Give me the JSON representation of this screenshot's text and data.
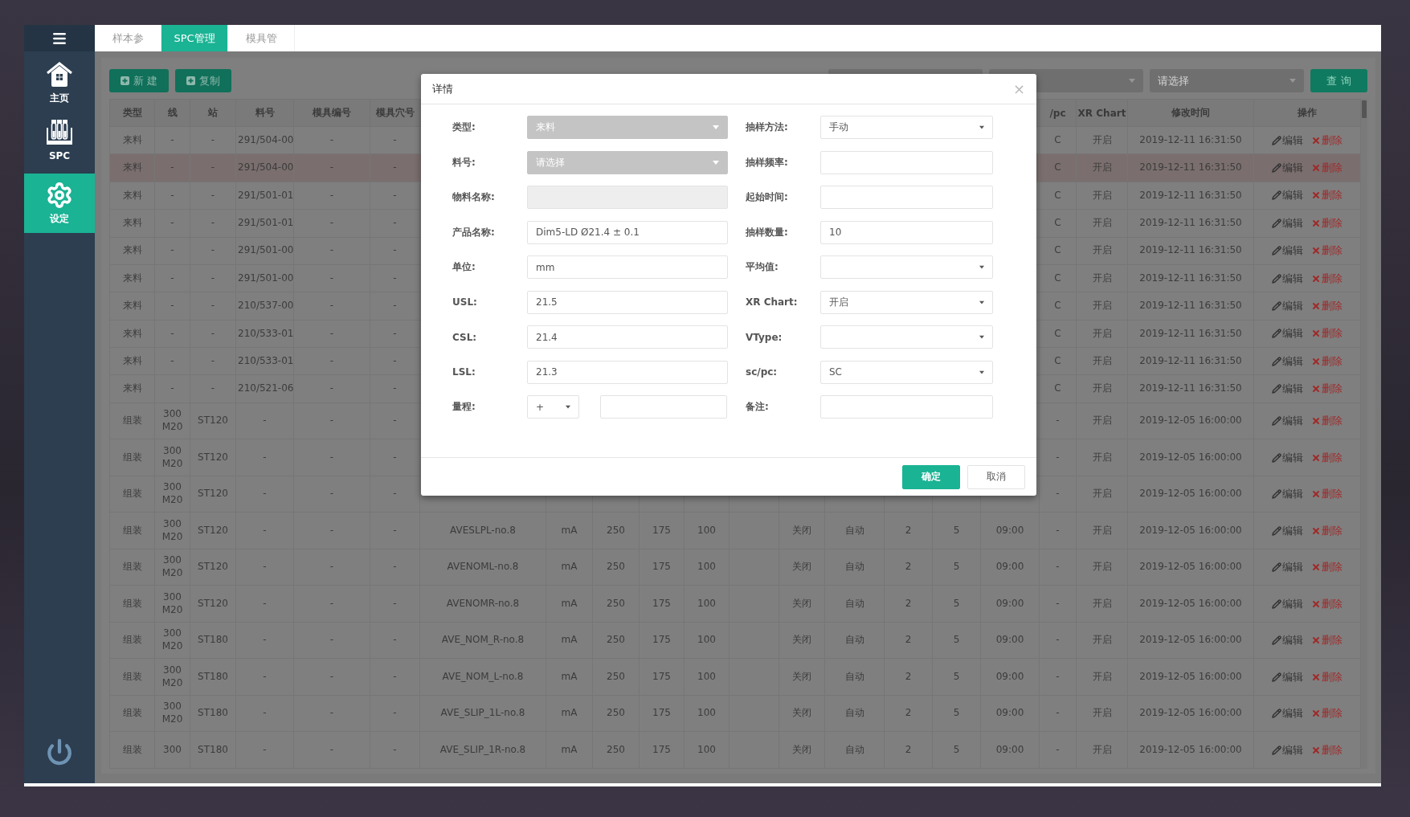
{
  "sidebar": {
    "items": [
      {
        "kind": "home",
        "label": "主页",
        "selected": false
      },
      {
        "kind": "spc",
        "label": "SPC",
        "selected": false
      },
      {
        "kind": "settings",
        "label": "设定",
        "selected": true
      }
    ]
  },
  "tabs": [
    {
      "label": "样本参",
      "selected": false
    },
    {
      "label": "SPC管理",
      "selected": true
    },
    {
      "label": "模具管",
      "selected": false
    }
  ],
  "toolbar": {
    "buttons": [
      "新 建",
      "复制"
    ],
    "filters": [
      {
        "kind": "empty"
      },
      {
        "kind": "empty"
      },
      {
        "kind": "choose",
        "placeholder": "请选择"
      }
    ],
    "search_button": "查 询"
  },
  "table": {
    "columns": [
      "类型",
      "线",
      "站",
      "料号",
      "模具编号",
      "模具穴号",
      null,
      null,
      null,
      null,
      null,
      null,
      null,
      null,
      null,
      null,
      null,
      "/pc",
      "XR Chart",
      "修改时间",
      "操作"
    ],
    "rows": [
      {
        "selected": false,
        "cells": [
          "来料",
          "-",
          "-",
          "291/504-00",
          "-",
          "-",
          null,
          null,
          null,
          null,
          null,
          null,
          null,
          null,
          null,
          null,
          null,
          "C",
          "开启",
          "2019-12-11 16:31:50"
        ],
        "actions": [
          "编辑",
          "删除"
        ]
      },
      {
        "selected": true,
        "cells": [
          "来料",
          "-",
          "-",
          "291/504-00",
          "-",
          "-",
          null,
          null,
          null,
          null,
          null,
          null,
          null,
          null,
          null,
          null,
          null,
          "C",
          "开启",
          "2019-12-11 16:31:50"
        ],
        "actions": [
          "编辑",
          "删除"
        ]
      },
      {
        "selected": false,
        "cells": [
          "来料",
          "-",
          "-",
          "291/501-01",
          "-",
          "-",
          null,
          null,
          null,
          null,
          null,
          null,
          null,
          null,
          null,
          null,
          null,
          "C",
          "开启",
          "2019-12-11 16:31:50"
        ],
        "actions": [
          "编辑",
          "删除"
        ]
      },
      {
        "selected": false,
        "cells": [
          "来料",
          "-",
          "-",
          "291/501-01",
          "-",
          "-",
          null,
          null,
          null,
          null,
          null,
          null,
          null,
          null,
          null,
          null,
          null,
          "C",
          "开启",
          "2019-12-11 16:31:50"
        ],
        "actions": [
          "编辑",
          "删除"
        ]
      },
      {
        "selected": false,
        "cells": [
          "来料",
          "-",
          "-",
          "291/501-00",
          "-",
          "-",
          null,
          null,
          null,
          null,
          null,
          null,
          null,
          null,
          null,
          null,
          null,
          "C",
          "开启",
          "2019-12-11 16:31:50"
        ],
        "actions": [
          "编辑",
          "删除"
        ]
      },
      {
        "selected": false,
        "cells": [
          "来料",
          "-",
          "-",
          "291/501-00",
          "-",
          "-",
          null,
          null,
          null,
          null,
          null,
          null,
          null,
          null,
          null,
          null,
          null,
          "C",
          "开启",
          "2019-12-11 16:31:50"
        ],
        "actions": [
          "编辑",
          "删除"
        ]
      },
      {
        "selected": false,
        "cells": [
          "来料",
          "-",
          "-",
          "210/537-00",
          "-",
          "-",
          null,
          null,
          null,
          null,
          null,
          null,
          null,
          null,
          null,
          null,
          null,
          "C",
          "开启",
          "2019-12-11 16:31:50"
        ],
        "actions": [
          "编辑",
          "删除"
        ]
      },
      {
        "selected": false,
        "cells": [
          "来料",
          "-",
          "-",
          "210/533-01",
          "-",
          "-",
          null,
          null,
          null,
          null,
          null,
          null,
          null,
          null,
          null,
          null,
          null,
          "C",
          "开启",
          "2019-12-11 16:31:50"
        ],
        "actions": [
          "编辑",
          "删除"
        ]
      },
      {
        "selected": false,
        "cells": [
          "来料",
          "-",
          "-",
          "210/533-01",
          "-",
          "-",
          null,
          null,
          null,
          null,
          null,
          null,
          null,
          null,
          null,
          null,
          null,
          "C",
          "开启",
          "2019-12-11 16:31:50"
        ],
        "actions": [
          "编辑",
          "删除"
        ]
      },
      {
        "selected": false,
        "cells": [
          "来料",
          "-",
          "-",
          "210/521-06",
          "-",
          "-",
          null,
          null,
          null,
          null,
          null,
          null,
          null,
          null,
          null,
          null,
          null,
          "C",
          "开启",
          "2019-12-11 16:31:50"
        ],
        "actions": [
          "编辑",
          "删除"
        ]
      },
      {
        "selected": false,
        "cells": [
          "组装",
          "300 M20",
          "ST120",
          "-",
          "-",
          "-",
          null,
          null,
          null,
          null,
          null,
          null,
          null,
          null,
          null,
          null,
          null,
          "-",
          "开启",
          "2019-12-05 16:00:00"
        ],
        "actions": [
          "编辑",
          "删除"
        ]
      },
      {
        "selected": false,
        "cells": [
          "组装",
          "300 M20",
          "ST120",
          "-",
          "-",
          "-",
          null,
          null,
          null,
          null,
          null,
          null,
          null,
          null,
          null,
          null,
          null,
          "-",
          "开启",
          "2019-12-05 16:00:00"
        ],
        "actions": [
          "编辑",
          "删除"
        ]
      },
      {
        "selected": false,
        "cells": [
          "组装",
          "300 M20",
          "ST120",
          "-",
          "-",
          "-",
          null,
          null,
          null,
          null,
          null,
          null,
          null,
          null,
          null,
          null,
          null,
          "-",
          "开启",
          "2019-12-05 16:00:00"
        ],
        "actions": [
          "编辑",
          "删除"
        ]
      },
      {
        "selected": false,
        "cells": [
          "组装",
          "300 M20",
          "ST120",
          "-",
          "-",
          "-",
          "AVESLPL-no.8",
          "mA",
          "250",
          "175",
          "100",
          null,
          "关闭",
          "自动",
          "2",
          "5",
          "09:00",
          "-",
          "开启",
          "2019-12-05 16:00:00"
        ],
        "actions": [
          "编辑",
          "删除"
        ]
      },
      {
        "selected": false,
        "cells": [
          "组装",
          "300 M20",
          "ST120",
          "-",
          "-",
          "-",
          "AVENOML-no.8",
          "mA",
          "250",
          "175",
          "100",
          null,
          "关闭",
          "自动",
          "2",
          "5",
          "09:00",
          "-",
          "开启",
          "2019-12-05 16:00:00"
        ],
        "actions": [
          "编辑",
          "删除"
        ]
      },
      {
        "selected": false,
        "cells": [
          "组装",
          "300 M20",
          "ST120",
          "-",
          "-",
          "-",
          "AVENOMR-no.8",
          "mA",
          "250",
          "175",
          "100",
          null,
          "关闭",
          "自动",
          "2",
          "5",
          "09:00",
          "-",
          "开启",
          "2019-12-05 16:00:00"
        ],
        "actions": [
          "编辑",
          "删除"
        ]
      },
      {
        "selected": false,
        "cells": [
          "组装",
          "300 M20",
          "ST180",
          "-",
          "-",
          "-",
          "AVE_NOM_R-no.8",
          "mA",
          "250",
          "175",
          "100",
          null,
          "关闭",
          "自动",
          "2",
          "5",
          "09:00",
          "-",
          "开启",
          "2019-12-05 16:00:00"
        ],
        "actions": [
          "编辑",
          "删除"
        ]
      },
      {
        "selected": false,
        "cells": [
          "组装",
          "300 M20",
          "ST180",
          "-",
          "-",
          "-",
          "AVE_NOM_L-no.8",
          "mA",
          "250",
          "175",
          "100",
          null,
          "关闭",
          "自动",
          "2",
          "5",
          "09:00",
          "-",
          "开启",
          "2019-12-05 16:00:00"
        ],
        "actions": [
          "编辑",
          "删除"
        ]
      },
      {
        "selected": false,
        "cells": [
          "组装",
          "300 M20",
          "ST180",
          "-",
          "-",
          "-",
          "AVE_SLIP_1L-no.8",
          "mA",
          "250",
          "175",
          "100",
          null,
          "关闭",
          "自动",
          "2",
          "5",
          "09:00",
          "-",
          "开启",
          "2019-12-05 16:00:00"
        ],
        "actions": [
          "编辑",
          "删除"
        ]
      },
      {
        "selected": false,
        "cells": [
          "组装",
          "300",
          "ST180",
          "-",
          "-",
          "-",
          "AVE_SLIP_1R-no.8",
          "mA",
          "250",
          "175",
          "100",
          null,
          "关闭",
          "自动",
          "2",
          "5",
          "09:00",
          "-",
          "开启",
          "2019-12-05 16:00:00"
        ],
        "actions": [
          "编辑",
          "删除"
        ]
      }
    ]
  },
  "dialog": {
    "title": "详情",
    "close": "×",
    "left": [
      {
        "label": "类型:",
        "kind": "select",
        "disabled": true,
        "value": "来料"
      },
      {
        "label": "料号:",
        "kind": "select",
        "disabled": true,
        "placeholder": "请选择"
      },
      {
        "label": "物料名称:",
        "kind": "input",
        "disabled": true
      },
      {
        "label": "产品名称:",
        "kind": "input",
        "disabled": false,
        "value": "Dim5-LD Ø21.4 ± 0.1"
      },
      {
        "label": "单位:",
        "kind": "input",
        "disabled": false,
        "value": "mm"
      },
      {
        "label": "USL:",
        "kind": "input",
        "disabled": false,
        "value": "21.5"
      },
      {
        "label": "CSL:",
        "kind": "input",
        "disabled": false,
        "value": "21.4"
      },
      {
        "label": "LSL:",
        "kind": "input",
        "disabled": false,
        "value": "21.3"
      },
      {
        "label": "量程:",
        "kind": "range",
        "disabled": false,
        "value": "+"
      }
    ],
    "right": [
      {
        "label": "抽样方法:",
        "kind": "select",
        "disabled": false,
        "value": "手动"
      },
      {
        "label": "抽样频率:",
        "kind": "input",
        "disabled": false
      },
      {
        "label": "起始时间:",
        "kind": "input",
        "disabled": false
      },
      {
        "label": "抽样数量:",
        "kind": "input",
        "disabled": false,
        "value": "10"
      },
      {
        "label": "平均值:",
        "kind": "select",
        "disabled": false
      },
      {
        "label": "XR Chart:",
        "kind": "select",
        "disabled": false,
        "value": "开启"
      },
      {
        "label": "VType:",
        "kind": "select",
        "disabled": false
      },
      {
        "label": "sc/pc:",
        "kind": "select",
        "disabled": false,
        "value": "SC"
      },
      {
        "label": "备注:",
        "kind": "input",
        "disabled": false
      }
    ],
    "buttons": [
      {
        "label": "确定",
        "kind": "primary"
      },
      {
        "label": "取消",
        "kind": "default"
      }
    ]
  }
}
